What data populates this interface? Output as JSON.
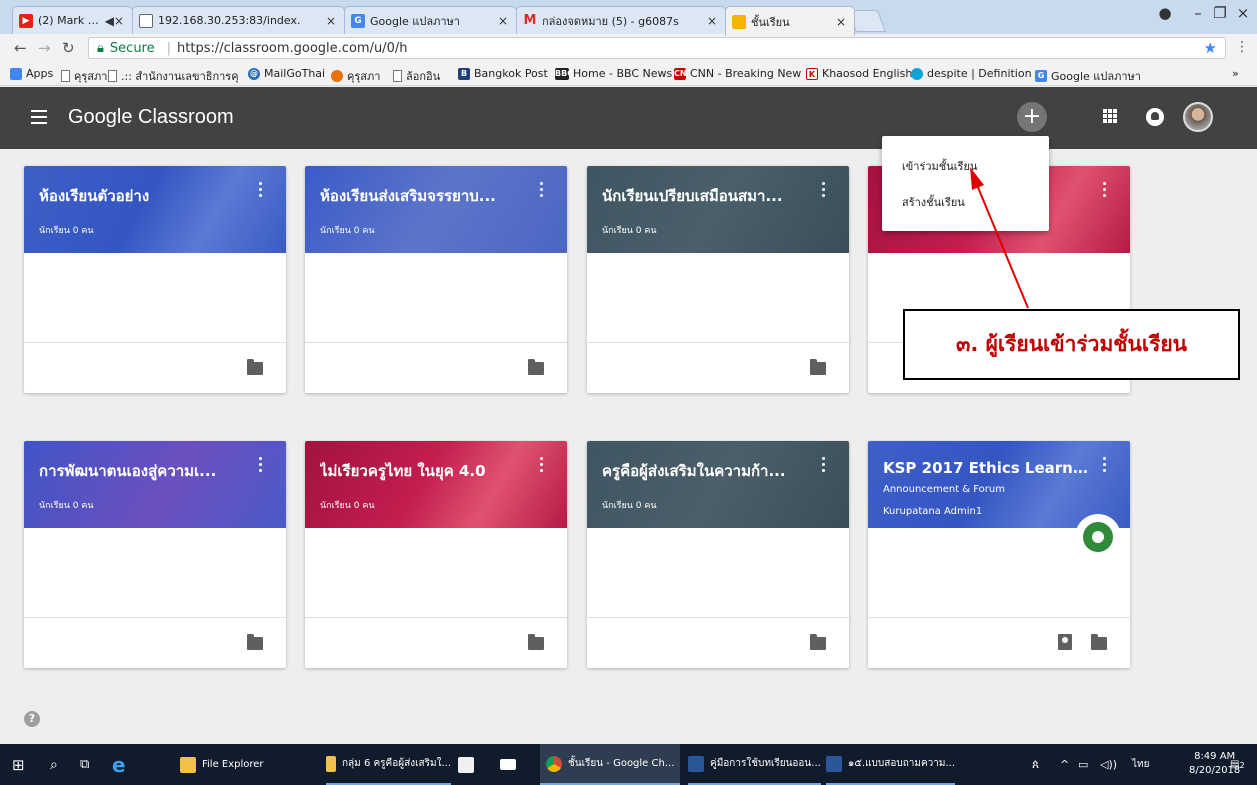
{
  "browser": {
    "tabs": [
      {
        "title": "(2) Mark Zuckerberg",
        "extra": "◀×",
        "icon": "youtube-icon",
        "color": "#e62117"
      },
      {
        "title": "192.168.30.253:83/index.",
        "icon": "page-icon",
        "color": "#ffffff"
      },
      {
        "title": "Google แปลภาษา",
        "icon": "translate-icon",
        "color": "#4285f4"
      },
      {
        "title": "กล่องจดหมาย (5) - g6087s",
        "icon": "gmail-icon",
        "color": "#d93025"
      },
      {
        "title": "ชั้นเรียน",
        "icon": "classroom-icon",
        "color": "#f4b400"
      }
    ],
    "secure_label": "Secure",
    "url": "https://classroom.google.com/u/0/h",
    "bookmarks": [
      {
        "label": "Apps"
      },
      {
        "label": "คุรุสภา"
      },
      {
        "label": ".:: สำนักงานเลขาธิการคุ"
      },
      {
        "label": "MailGoThai"
      },
      {
        "label": "คุรุสภา"
      },
      {
        "label": "ล้อกอิน"
      },
      {
        "label": "Bangkok Post"
      },
      {
        "label": "Home - BBC News"
      },
      {
        "label": "CNN - Breaking New"
      },
      {
        "label": "Khaosod English"
      },
      {
        "label": "despite | Definition o"
      },
      {
        "label": "Google แปลภาษา"
      }
    ],
    "more": "»"
  },
  "app": {
    "title": "Google Classroom",
    "menu": {
      "join": "เข้าร่วมชั้นเรียน",
      "create": "สร้างชั้นเรียน"
    }
  },
  "classes": [
    {
      "title": "ห้องเรียนตัวอย่าง",
      "sub": "นักเรียน 0 คน",
      "theme": "blue"
    },
    {
      "title": "ห้องเรียนส่งเสริมจรรยาบ...",
      "sub": "นักเรียน 0 คน",
      "theme": "blue2"
    },
    {
      "title": "นักเรียนเปรียบเสมือนสมา...",
      "sub": "นักเรียน 0 คน",
      "theme": "slate"
    },
    {
      "title": "",
      "sub": "นักเรียน 0 คน",
      "theme": "red"
    },
    {
      "title": "การพัฒนาตนเองสู่ความเ...",
      "sub": "นักเรียน 0 คน",
      "theme": "purple"
    },
    {
      "title": "ไม่เรียวครูไทย ในยุค 4.0",
      "sub": "นักเรียน 0 คน",
      "theme": "red"
    },
    {
      "title": "ครูคือผู้ส่งเสริมในความก้า...",
      "sub": "นักเรียน 0 คน",
      "theme": "slate"
    },
    {
      "title": "KSP 2017 Ethics Learn...",
      "sub": "Announcement & Forum",
      "sub2": "Kurupatana Admin1",
      "theme": "blue"
    }
  ],
  "annotation": {
    "text": "๓. ผู้เรียนเข้าร่วมชั้นเรียน",
    "color": "#c00000"
  },
  "taskbar": {
    "items": [
      {
        "label": "File Explorer"
      },
      {
        "label": "กลุ่ม 6 ครูคือผู้ส่งเสริมใ..."
      },
      {
        "label": "ชั้นเรียน - Google Ch..."
      },
      {
        "label": "คู่มือการใช้บทเรียนออน..."
      },
      {
        "label": "๑๕.แบบสอบถามความ..."
      }
    ],
    "lang": "ไทย",
    "time": "8:49 AM",
    "date": "8/20/2018",
    "notifications": "2"
  }
}
